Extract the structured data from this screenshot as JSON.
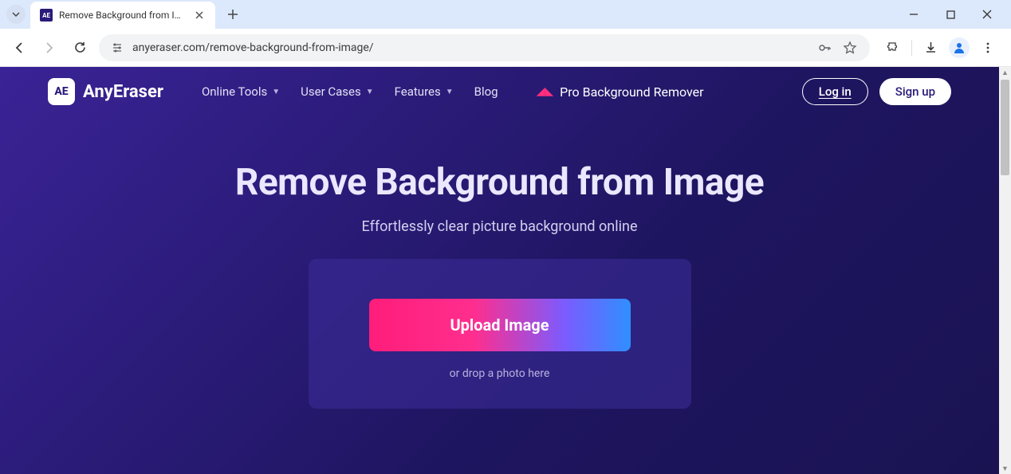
{
  "browser": {
    "tab_title": "Remove Background from Imag",
    "url": "anyeraser.com/remove-background-from-image/",
    "favicon_text": "AE"
  },
  "header": {
    "logo_badge": "AE",
    "logo_text": "AnyEraser",
    "nav": {
      "online_tools": "Online Tools",
      "user_cases": "User Cases",
      "features": "Features",
      "blog": "Blog",
      "pro": "Pro Background Remover"
    },
    "login": "Log in",
    "signup": "Sign up"
  },
  "hero": {
    "title": "Remove Background from Image",
    "subtitle": "Effortlessly clear picture background online"
  },
  "upload": {
    "button": "Upload Image",
    "drop_hint": "or drop a photo here"
  }
}
